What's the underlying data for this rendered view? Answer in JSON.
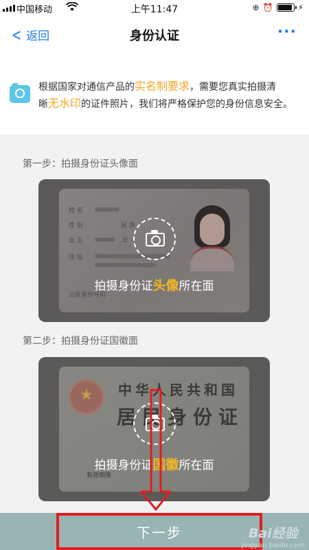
{
  "status_bar": {
    "carrier": "中国移动",
    "time": "上午11:47",
    "battery_level": 0.95
  },
  "nav": {
    "back_label": "返回",
    "title": "身份认证",
    "more_label": "···"
  },
  "notice": {
    "line1_pre": "根据国家对通信产品的",
    "line1_hl": "实名制要求",
    "line1_post": "，需要您真实拍摄清",
    "line2_pre": "晰",
    "line2_hl": "无水印",
    "line2_post": "的证件照片，我们将严格保护您的身份信息安全。"
  },
  "step1": {
    "label": "第一步：拍摄身份证头像面",
    "caption_pre": "拍摄身份证",
    "caption_hl": "头像",
    "caption_post": "所在面",
    "fields": {
      "name": "姓 名",
      "sex": "性 别",
      "nation": "民 族",
      "birth": "出 生",
      "year": "年",
      "address": "住 址",
      "id_number": "公民身份号码"
    }
  },
  "step2": {
    "label": "第二步：拍摄身份证国徽面",
    "caption_pre": "拍摄身份证",
    "caption_hl": "国徽",
    "caption_post": "所在面",
    "card_title": "中华人民共和国",
    "card_big": "居民身份证",
    "valid_label": "有效期限"
  },
  "bottom": {
    "next_label": "下一步"
  },
  "watermark": {
    "main": "Bai经验",
    "sub": "jingyan.baidu.com"
  },
  "colors": {
    "accent_blue": "#1a7cf0",
    "highlight_orange": "#f5a623",
    "annotation_red": "#e01e1e",
    "bottom_bar": "#9ab3b3"
  }
}
